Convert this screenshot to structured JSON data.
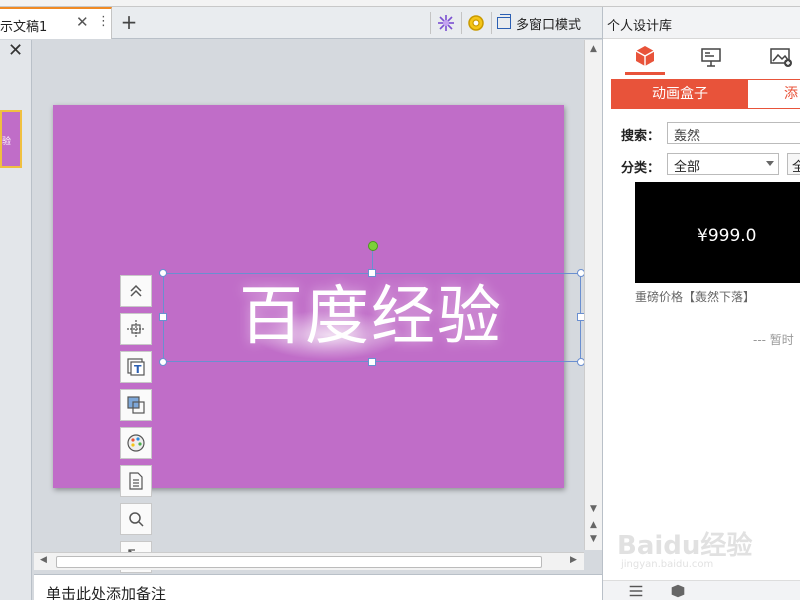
{
  "document_tab": {
    "title": "示文稿1",
    "close": "✕",
    "more": "⋮"
  },
  "toolbar": {
    "new_tab": "+",
    "multi_window_label": "多窗口模式"
  },
  "thumbnails": {
    "close": "✕",
    "slide1_text": "验"
  },
  "slide": {
    "text": "百度经验",
    "background": "#c06dc8"
  },
  "float_toolbar": {
    "items": [
      "collapse-up",
      "align-center",
      "text-box",
      "layer",
      "palette",
      "document",
      "search",
      "resize"
    ]
  },
  "notes": {
    "placeholder": "单击此处添加备注"
  },
  "panel": {
    "title": "个人设计库",
    "icon_tabs": [
      "cube-icon",
      "presentation-icon",
      "image-add-icon"
    ],
    "subtabs": {
      "active": "动画盒子",
      "other": "添"
    },
    "search": {
      "label": "搜索：",
      "value": "轰然"
    },
    "category": {
      "label": "分类：",
      "value": "全部",
      "button": "全"
    },
    "preview": {
      "text": "¥999.0",
      "caption": "重磅价格【轰然下落】"
    },
    "empty_text": "--- 暂时"
  },
  "watermark": {
    "main": "Baidu经验",
    "sub": "jingyan.baidu.com"
  },
  "colors": {
    "accent": "#e8533a",
    "tab_accent": "#f08a24",
    "selection": "#6a8fd0",
    "rotate_handle": "#7dd13a"
  }
}
